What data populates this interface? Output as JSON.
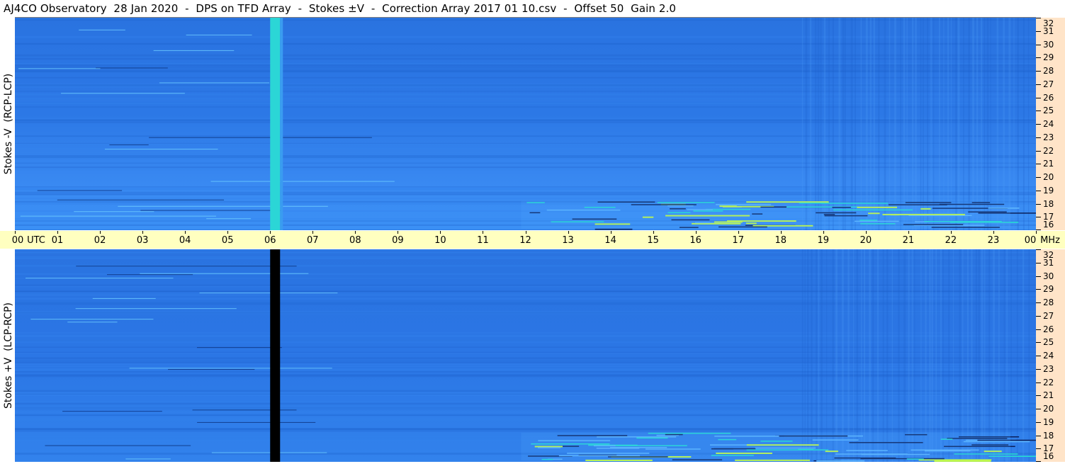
{
  "title": "AJ4CO Observatory  28 Jan 2020  -  DPS on TFD Array  -  Stokes ±V  -  Correction Array 2017 01 10.csv  -  Offset 50  Gain 2.0",
  "colors": {
    "background": "#2b76e5",
    "utc_bar": "#ffffc0",
    "freq_axis": "#ffe4c8"
  },
  "chart_data": [
    {
      "type": "heatmap",
      "panel": "top",
      "ylabel": "Stokes -V  (RCP-LCP)",
      "x_ticks": [
        "00",
        "01",
        "02",
        "03",
        "04",
        "05",
        "06",
        "07",
        "08",
        "09",
        "10",
        "11",
        "12",
        "13",
        "14",
        "15",
        "16",
        "17",
        "18",
        "19",
        "20",
        "21",
        "22",
        "23",
        "00"
      ],
      "x_unit": "UTC",
      "xlim": [
        0,
        24
      ],
      "y_ticks": [
        "16",
        "17",
        "18",
        "19",
        "20",
        "21",
        "22",
        "23",
        "24",
        "25",
        "26",
        "27",
        "28",
        "29",
        "30",
        "31",
        "32"
      ],
      "y_unit": "MHz",
      "ylim": [
        16,
        32
      ],
      "features": [
        {
          "kind": "vertical_band",
          "time_start": 6.0,
          "time_end": 6.3,
          "color": "#2bd6d6"
        },
        {
          "kind": "noise_streaks",
          "time_start": 11.9,
          "time_end": 23.4,
          "freq_min": 16.1,
          "freq_max": 18.2
        }
      ]
    },
    {
      "type": "heatmap",
      "panel": "bottom",
      "ylabel": "Stokes +V  (LCP-RCP)",
      "x_ticks": [
        "00",
        "01",
        "02",
        "03",
        "04",
        "05",
        "06",
        "07",
        "08",
        "09",
        "10",
        "11",
        "12",
        "13",
        "14",
        "15",
        "16",
        "17",
        "18",
        "19",
        "20",
        "21",
        "22",
        "23",
        "00"
      ],
      "x_unit": "UTC",
      "xlim": [
        0,
        24
      ],
      "y_ticks": [
        "16",
        "17",
        "18",
        "19",
        "20",
        "21",
        "22",
        "23",
        "24",
        "25",
        "26",
        "27",
        "28",
        "29",
        "30",
        "31",
        "32"
      ],
      "y_unit": "MHz",
      "ylim": [
        16,
        32
      ],
      "features": [
        {
          "kind": "vertical_band",
          "time_start": 6.0,
          "time_end": 6.3,
          "color": "#000000"
        },
        {
          "kind": "noise_streaks",
          "time_start": 11.9,
          "time_end": 23.4,
          "freq_min": 16.1,
          "freq_max": 18.2
        }
      ]
    }
  ]
}
